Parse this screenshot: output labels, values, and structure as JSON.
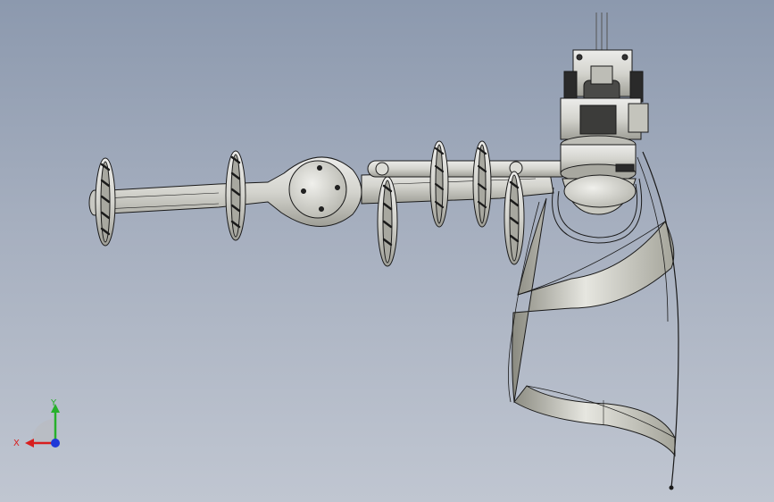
{
  "viewport": {
    "background_top": "#8c99ae",
    "background_bottom": "#c0c6d1"
  },
  "triad": {
    "x_label": "X",
    "y_label": "Y",
    "x_color": "#d81e1e",
    "y_color": "#27b02b",
    "z_color": "#1f38d8"
  },
  "model": {
    "part_fill": "#d8d8d2",
    "part_shade": "#b0b0a8",
    "edge_color": "#1a1a1a",
    "icons": [
      "robot-arm-assembly",
      "coordinate-triad-icon"
    ]
  }
}
